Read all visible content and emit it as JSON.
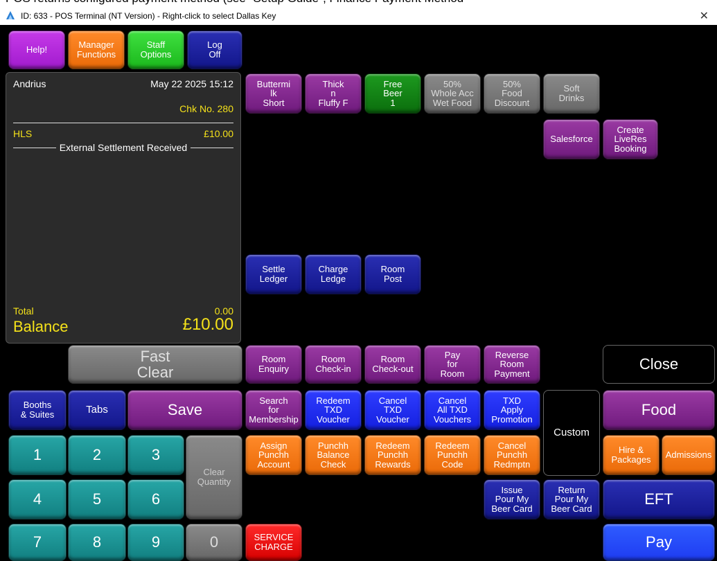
{
  "top_fragment": "POS returns configured payment method (see \"Setup Guide\", Finance Payment Method",
  "window": {
    "title": "ID: 633 - POS Terminal (NT Version) - Right-click to select Dallas Key",
    "close_glyph": "✕"
  },
  "top_buttons": {
    "help": "Help!",
    "manager": "Manager\nFunctions",
    "staff": "Staff\nOptions",
    "logoff": "Log\nOff"
  },
  "receipt": {
    "user": "Andrius",
    "datetime": "May 22 2025 15:12",
    "check": "Chk No. 280",
    "item_name": "HLS",
    "item_price": "£10.00",
    "settlement_text": "External Settlement Received",
    "total_label": "Total",
    "total_value": "0.00",
    "balance_label": "Balance",
    "balance_value": "£10.00"
  },
  "menu_buttons": {
    "buttermilk": "Buttermi\nlk\nShort",
    "thick": "Thick\nn\nFluffy F",
    "free_beer": "Free\nBeer\n1",
    "whole_acc": "50%\nWhole Acc\nWet Food",
    "food_discount": "50%\nFood\nDiscount",
    "soft_drinks": "Soft\nDrinks",
    "salesforce": "Salesforce",
    "liveres": "Create\nLiveRes\nBooking",
    "settle_ledger": "Settle\nLedger",
    "charge_ledge": "Charge\nLedge",
    "room_post": "Room\nPost"
  },
  "fast_clear": "Fast\nClear",
  "room_buttons": {
    "enquiry": "Room\nEnquiry",
    "checkin": "Room\nCheck-in",
    "checkout": "Room\nCheck-out",
    "pay": "Pay\nfor\nRoom",
    "reverse": "Reverse\nRoom\nPayment"
  },
  "txd_buttons": {
    "search": "Search\nfor\nMembership",
    "redeem": "Redeem\nTXD\nVoucher",
    "cancel": "Cancel\nTXD\nVoucher",
    "cancel_all": "Cancel\nAll TXD\nVouchers",
    "promo": "TXD\nApply\nPromotion"
  },
  "punchh_buttons": {
    "assign": "Assign\nPunchh\nAccount",
    "balance": "Punchh\nBalance\nCheck",
    "rewards": "Redeem\nPunchh\nRewards",
    "code": "Redeem\nPunchh\nCode",
    "cancel": "Cancel\nPunchh\nRedmptn"
  },
  "pour_buttons": {
    "issue": "Issue\nPour My\nBeer Card",
    "return": "Return\nPour My\nBeer Card"
  },
  "right_buttons": {
    "close": "Close",
    "food": "Food",
    "custom": "Custom",
    "hire": "Hire &\nPackages",
    "admissions": "Admissions",
    "eft": "EFT",
    "pay": "Pay"
  },
  "left_buttons": {
    "booths": "Booths\n& Suites",
    "tabs": "Tabs",
    "save": "Save",
    "clear_qty": "Clear\nQuantity",
    "service": "SERVICE\nCHARGE"
  },
  "keypad": [
    "1",
    "2",
    "3",
    "4",
    "5",
    "6",
    "7",
    "8",
    "9",
    "0"
  ],
  "colors": {
    "purple": "#7f2489",
    "orange": "#f07410",
    "teal": "#1a9394",
    "navy": "#1a1f9e",
    "blue": "#1c2cf0",
    "balance_yellow": "#f5e21a"
  }
}
